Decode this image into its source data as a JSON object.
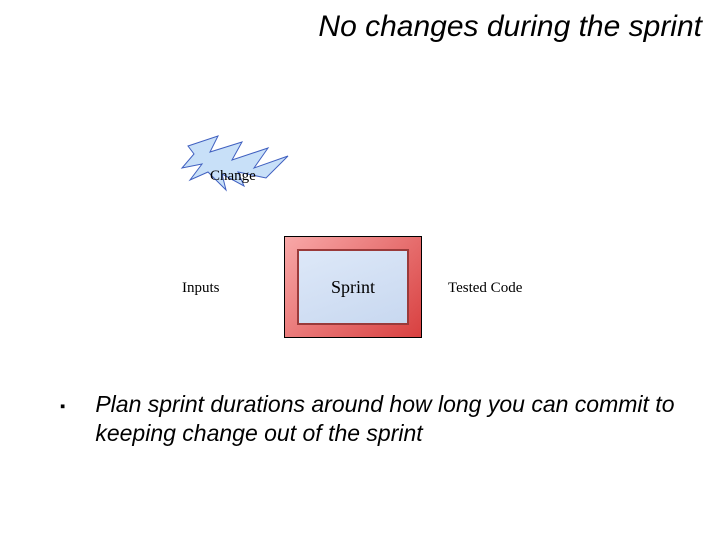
{
  "title": "No changes during the sprint",
  "labels": {
    "change": "Change",
    "inputs": "Inputs",
    "sprint": "Sprint",
    "tested": "Tested Code"
  },
  "bullet": {
    "mark": "▪",
    "text": "Plan sprint durations around how long you can commit to keeping change out of the sprint"
  }
}
